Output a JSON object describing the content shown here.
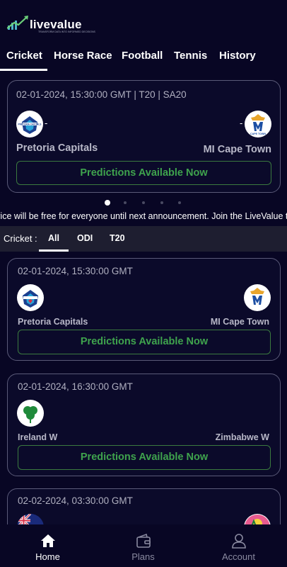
{
  "app": {
    "brand": "livevalue",
    "tagline": "TRANSFORM DATA INTO INFORMED DECISIONS"
  },
  "tabs": [
    "Cricket",
    "Horse Race",
    "Football",
    "Tennis",
    "History"
  ],
  "featured": {
    "date": "02-01-2024, 15:30:00 GMT",
    "meta": " | T20 | SA20",
    "team_a": "Pretoria Capitals",
    "team_b": "MI Cape Town",
    "dash": "-",
    "cta": "Predictions Available Now"
  },
  "carousel": {
    "count": 5,
    "active": 0
  },
  "announcement": "rvice will be free for everyone until next announcement. Join the LiveValue toda",
  "filter": {
    "label": "Cricket :",
    "chips": [
      "All",
      "ODI",
      "T20"
    ],
    "active": "All"
  },
  "matches": [
    {
      "date": "02-01-2024, 15:30:00 GMT",
      "team_a": "Pretoria Capitals",
      "team_b": "MI Cape Town",
      "cta": "Predictions Available Now"
    },
    {
      "date": "02-01-2024, 16:30:00 GMT",
      "team_a": "Ireland W",
      "team_b": "Zimbabwe W",
      "cta": "Predictions Available Now"
    },
    {
      "date": "02-02-2024, 03:30:00 GMT"
    }
  ],
  "bottom_nav": {
    "items": [
      "Home",
      "Plans",
      "Account"
    ],
    "active": "Home"
  },
  "logos": {
    "pretoria_capitals": "PRETORIA CAPITALS",
    "mi_cape_town": "CAPE TOWN"
  },
  "colors": {
    "background": "#080624",
    "cta_green": "#3fa34d",
    "card_border": "#5a5a78"
  }
}
